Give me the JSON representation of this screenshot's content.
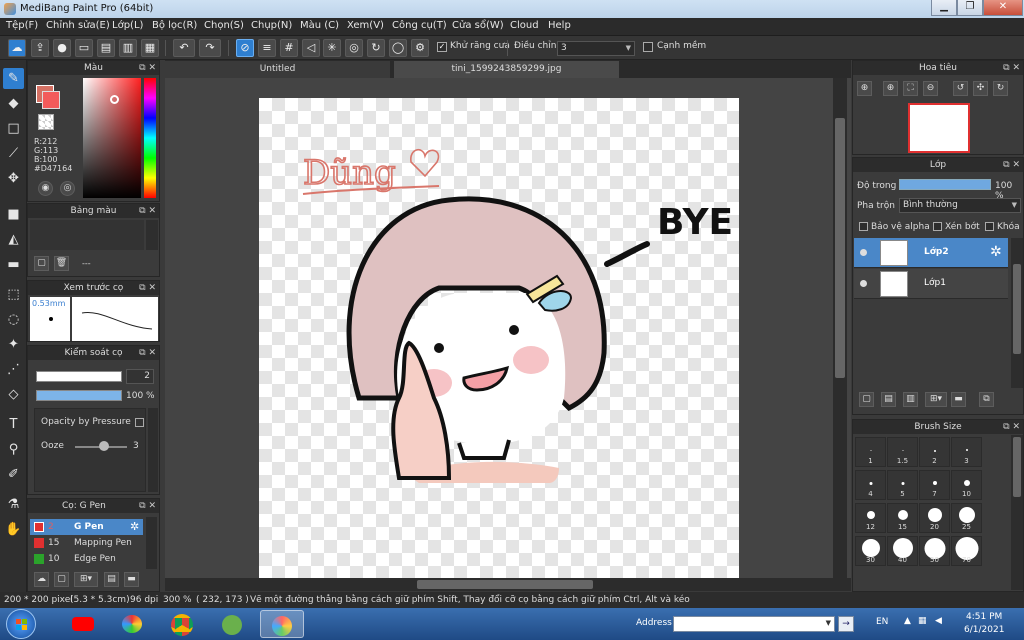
{
  "window": {
    "title": "MediBang Paint Pro (64bit)"
  },
  "menu": [
    "Tệp(F)",
    "Chỉnh sửa(E)",
    "Lớp(L)",
    "Bộ lọc(R)",
    "Chọn(S)",
    "Chụp(N)",
    "Màu (C)",
    "Xem(V)",
    "Công cụ(T)",
    "Cửa sổ(W)",
    "Cloud",
    "Help"
  ],
  "toolbar": {
    "antialias_label": "Khử răng cưa",
    "correction_label": "Điều chỉnh",
    "correction_value": "3",
    "soft_edge_label": "Cạnh mềm"
  },
  "color_panel": {
    "title": "Màu",
    "r": "R:212",
    "g": "G:113",
    "b": "B:100",
    "hex": "#D47164",
    "foreground": "#d47164"
  },
  "palette_panel": {
    "title": "Bảng màu",
    "placeholder": "---"
  },
  "brush_preview": {
    "title": "Xem trước cọ",
    "size": "0.53mm"
  },
  "brush_control": {
    "title": "Kiểm soát cọ",
    "size_value": "2",
    "opacity_value": "100 %",
    "opacity_fraction": 1.0,
    "opacity_pressure_label": "Opacity by Pressure",
    "ooze_label": "Ooze",
    "ooze_value": "3"
  },
  "brush_list": {
    "title": "Cọ: G Pen",
    "items": [
      {
        "num": "2",
        "name": "G Pen",
        "color": "#e03030",
        "selected": true
      },
      {
        "num": "15",
        "name": "Mapping Pen",
        "color": "#e03030",
        "selected": false
      },
      {
        "num": "10",
        "name": "Edge Pen",
        "color": "#2ba32b",
        "selected": false
      }
    ]
  },
  "tabs": [
    "Untitled",
    "tini_1599243859299.jpg"
  ],
  "navigator": {
    "title": "Hoa tiêu"
  },
  "layer_panel": {
    "title": "Lớp",
    "opacity_label": "Độ trong",
    "opacity_value": "100 %",
    "opacity_fraction": 1.0,
    "blend_label": "Pha trộn",
    "blend_value": "Bình thường",
    "protect_alpha": "Bảo vệ alpha",
    "clipping": "Xén bớt",
    "lock": "Khóa",
    "layers": [
      {
        "name": "Lớp2",
        "selected": true
      },
      {
        "name": "Lớp1",
        "selected": false
      }
    ]
  },
  "brush_size": {
    "title": "Brush Size",
    "sizes": [
      "1",
      "1.5",
      "2",
      "3",
      "4",
      "5",
      "7",
      "10",
      "12",
      "15",
      "20",
      "25",
      "30",
      "40",
      "50",
      "70"
    ]
  },
  "artwork": {
    "signature": "Dũng",
    "speech": "BYE"
  },
  "status": {
    "dimensions": "200 * 200 pixel",
    "physical": "(5.3 * 5.3cm)",
    "dpi": "96 dpi",
    "zoom": "300 %",
    "coords": "( 232, 173 )",
    "hint": "Vẽ một đường thẳng bằng cách giữ phím Shift, Thay đổi cỡ cọ bằng cách giữ phím Ctrl, Alt và kéo"
  },
  "taskbar": {
    "address_label": "Address",
    "lang": "EN",
    "time": "4:51 PM",
    "date": "6/1/2021"
  }
}
